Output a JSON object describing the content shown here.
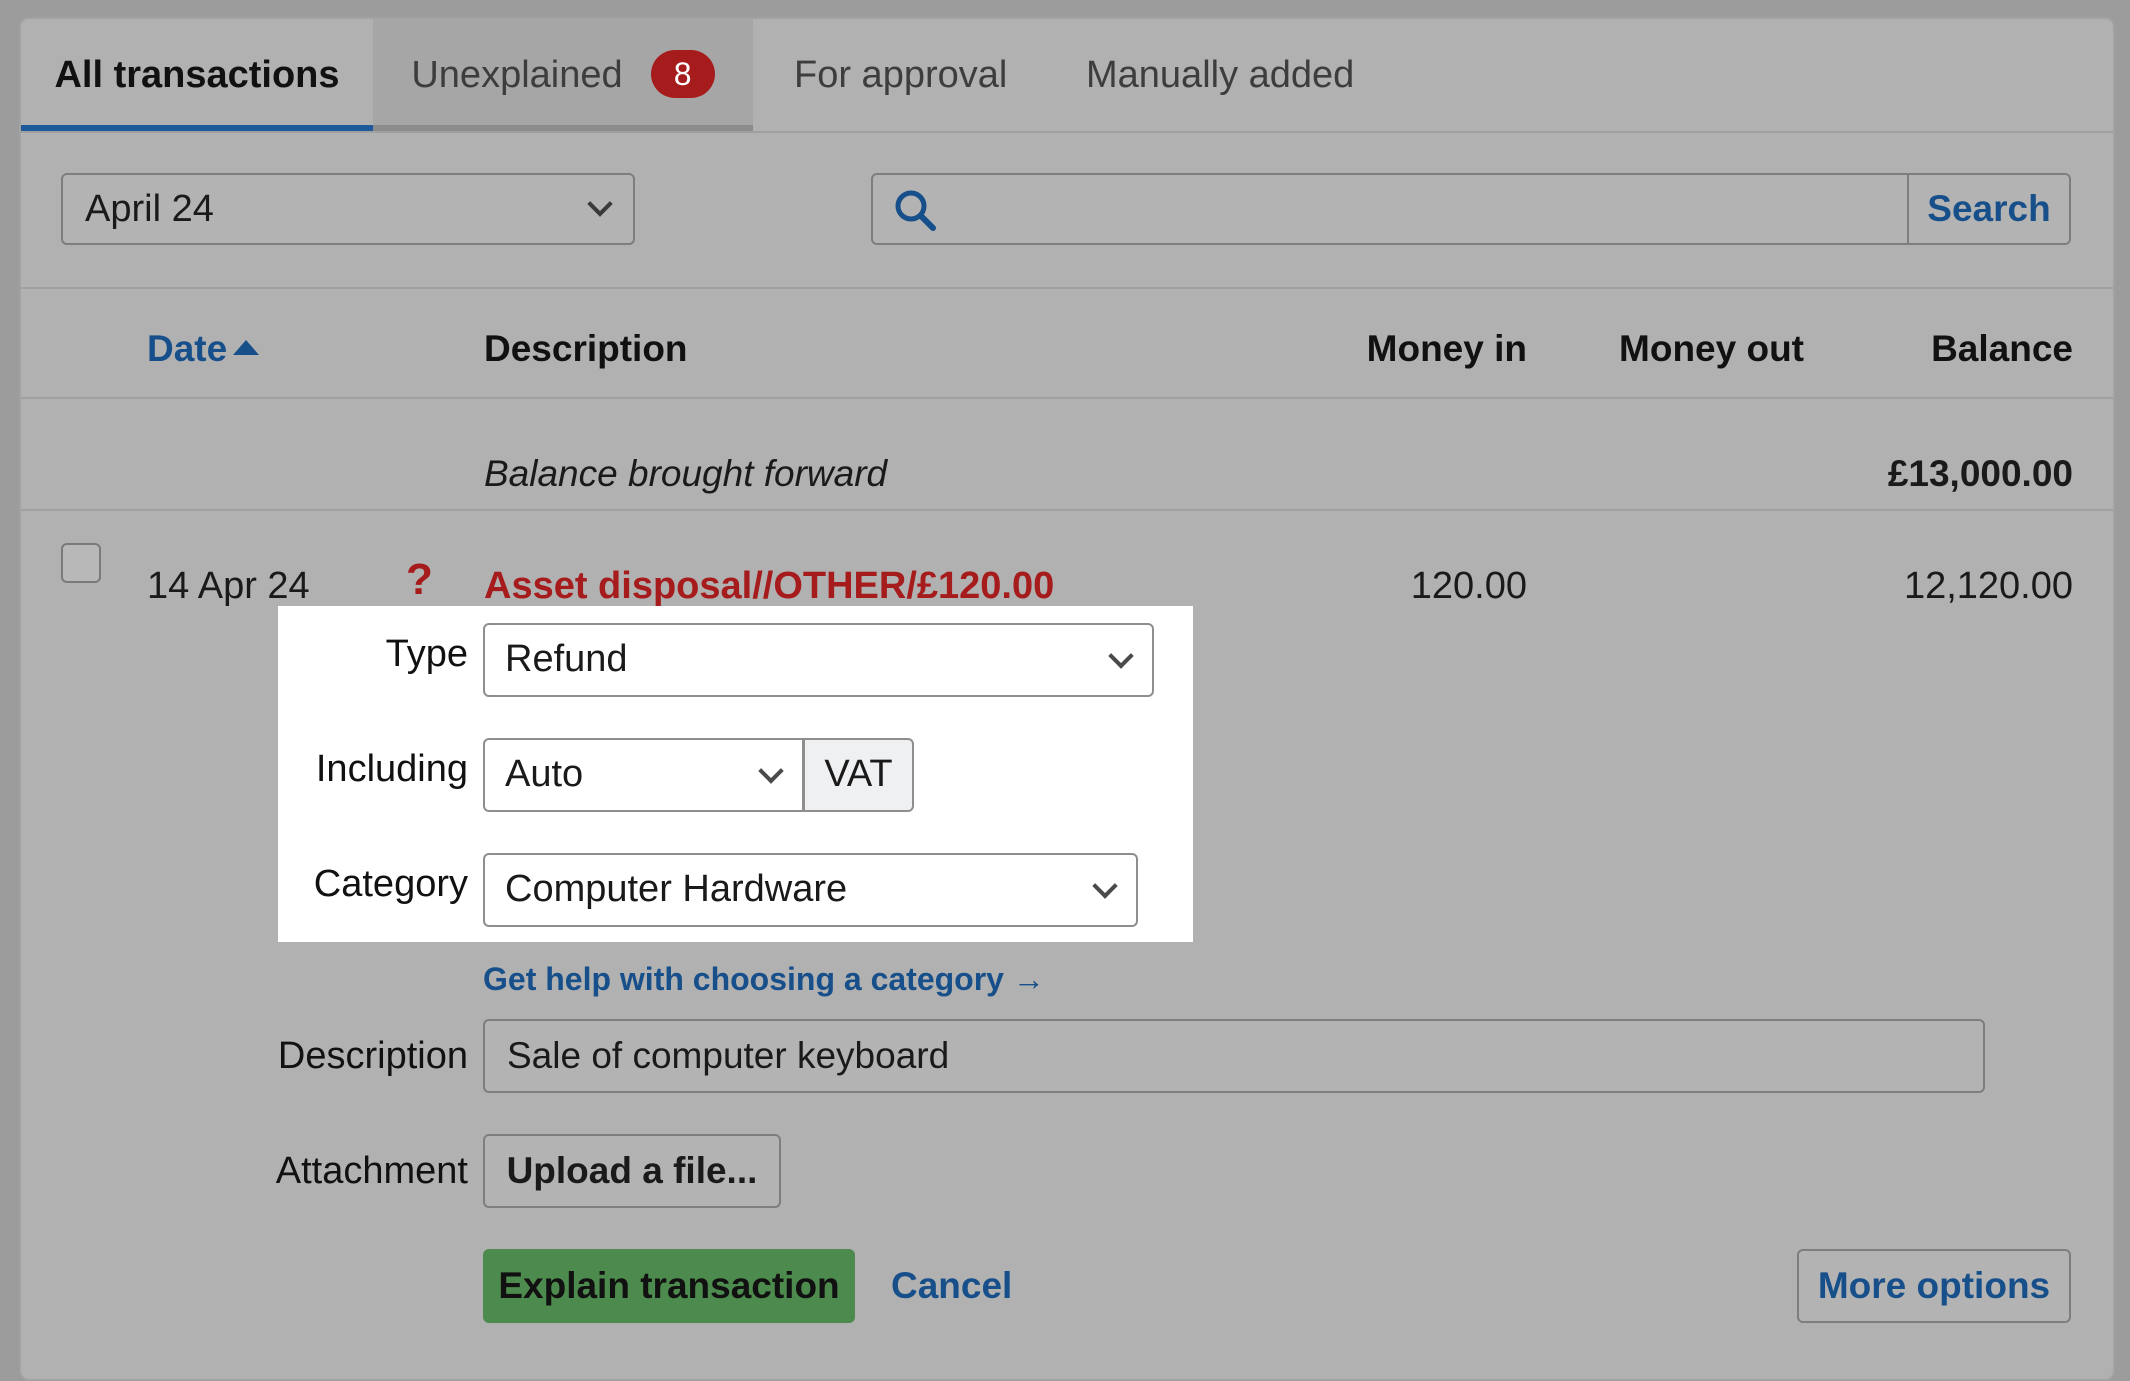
{
  "tabs": [
    {
      "label": "All transactions"
    },
    {
      "label": "Unexplained",
      "badge": "8"
    },
    {
      "label": "For approval"
    },
    {
      "label": "Manually added"
    }
  ],
  "filters": {
    "period_value": "April 24",
    "search_placeholder": "",
    "search_button": "Search"
  },
  "table": {
    "headers": {
      "date": "Date",
      "description": "Description",
      "money_in": "Money in",
      "money_out": "Money out",
      "balance": "Balance"
    },
    "brought_forward": {
      "label": "Balance brought forward",
      "balance": "£13,000.00"
    },
    "row": {
      "date": "14 Apr 24",
      "status": "?",
      "description": "Asset disposal//OTHER/£120.00",
      "money_in": "120.00",
      "money_out": "",
      "balance": "12,120.00"
    }
  },
  "form": {
    "type_label": "Type",
    "type_value": "Refund",
    "including_label": "Including",
    "including_value": "Auto",
    "vat_label": "VAT",
    "category_label": "Category",
    "category_value": "Computer Hardware",
    "help_link": "Get help with choosing a category →",
    "description_label": "Description",
    "description_value": "Sale of computer keyboard",
    "attachment_label": "Attachment",
    "upload_button": "Upload a file...",
    "explain_button": "Explain transaction",
    "cancel_link": "Cancel",
    "more_options_button": "More options"
  },
  "colors": {
    "accent_blue": "#174f8a",
    "error_red": "#a61b1b",
    "primary_green": "#4d8a4d"
  }
}
